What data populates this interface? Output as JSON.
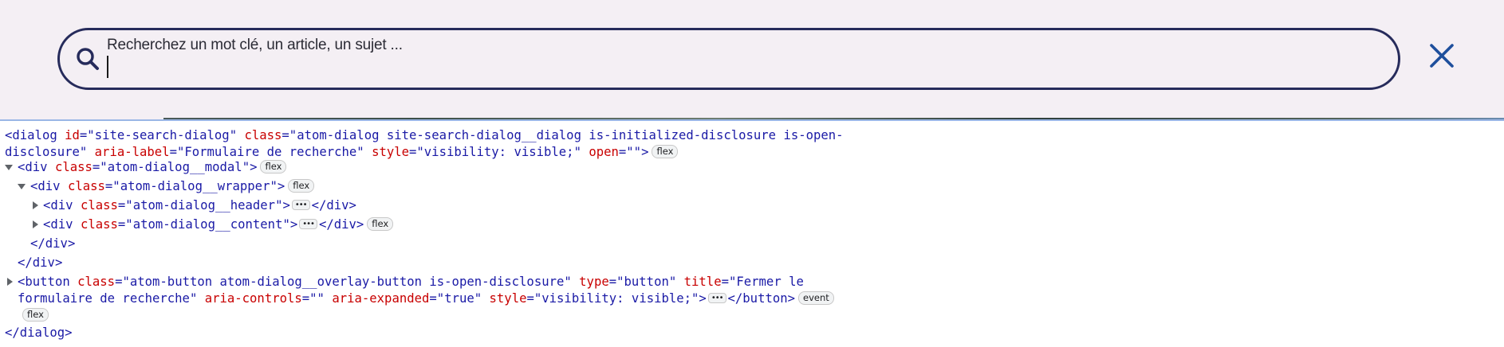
{
  "search": {
    "label": "Recherchez un mot clé, un article, un sujet ...",
    "value": ""
  },
  "colors": {
    "search_border": "#262b5b",
    "search_bg": "#f4eff4",
    "close_icon": "#1e4f9c",
    "tag_color": "#1a1aa6",
    "attr_color": "#c80000"
  },
  "devtools": {
    "dialog_tag": "dialog",
    "dialog_id_attr": "id",
    "dialog_id_val": "site-search-dialog",
    "dialog_class_attr": "class",
    "dialog_class_val_1": "atom-dialog site-search-dialog__dialog is-initialized-disclosure is-open-",
    "dialog_class_val_2": "disclosure",
    "dialog_aria_attr": "aria-label",
    "dialog_aria_val": "Formulaire de recherche",
    "dialog_style_attr": "style",
    "dialog_style_val": "visibility: visible;",
    "dialog_open_attr": "open",
    "dialog_open_val": "",
    "modal_tag": "div",
    "modal_class_attr": "class",
    "modal_class_val": "atom-dialog__modal",
    "wrapper_tag": "div",
    "wrapper_class_attr": "class",
    "wrapper_class_val": "atom-dialog__wrapper",
    "header_tag": "div",
    "header_class_attr": "class",
    "header_class_val": "atom-dialog__header",
    "content_tag": "div",
    "content_class_attr": "class",
    "content_class_val": "atom-dialog__content",
    "close_div": "div",
    "close_dialog": "dialog",
    "button_tag": "button",
    "button_class_attr": "class",
    "button_class_val": "atom-button atom-dialog__overlay-button is-open-disclosure",
    "button_type_attr": "type",
    "button_type_val": "button",
    "button_title_attr": "title",
    "button_title_val_1": "Fermer le",
    "button_title_val_2": "formulaire de recherche",
    "button_controls_attr": "aria-controls",
    "button_controls_val": "",
    "button_expanded_attr": "aria-expanded",
    "button_expanded_val": "true",
    "button_style_attr": "style",
    "button_style_val": "visibility: visible;",
    "badge_flex": "flex",
    "badge_event": "event",
    "ellipsis": "•••"
  }
}
